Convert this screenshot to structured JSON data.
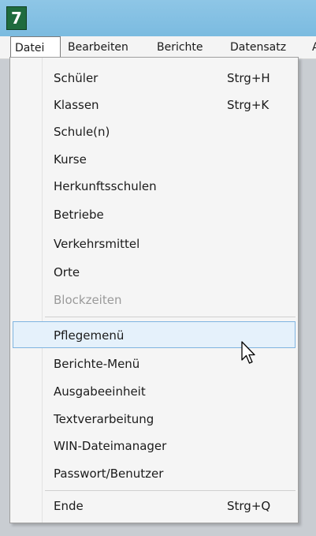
{
  "app": {
    "icon_glyph": "7",
    "icon_color": "#1f6b3e"
  },
  "menubar": {
    "items": [
      {
        "label": "Datei"
      },
      {
        "label": "Bearbeiten"
      },
      {
        "label": "Berichte"
      },
      {
        "label": "Datensatz"
      },
      {
        "label": "A"
      }
    ]
  },
  "menu": {
    "items": [
      {
        "label": "Schüler",
        "shortcut": "Strg+H"
      },
      {
        "label": "Klassen",
        "shortcut": "Strg+K"
      },
      {
        "label": "Schule(n)"
      },
      {
        "label": "Kurse"
      },
      {
        "label": "Herkunftsschulen"
      },
      {
        "label": "Betriebe"
      },
      {
        "label": "Verkehrsmittel"
      },
      {
        "label": "Orte"
      },
      {
        "label": "Blockzeiten",
        "disabled": true
      },
      {
        "label": "Pflegemenü",
        "highlighted": true
      },
      {
        "label": "Berichte-Menü"
      },
      {
        "label": "Ausgabeeinheit"
      },
      {
        "label": "Textverarbeitung"
      },
      {
        "label": "WIN-Dateimanager"
      },
      {
        "label": "Passwort/Benutzer"
      },
      {
        "label": "Ende",
        "shortcut": "Strg+Q"
      }
    ]
  },
  "colors": {
    "highlight_bg": "#e5f1fb",
    "highlight_border": "#7fb4e0",
    "disabled_text": "#9a9a9a"
  },
  "cursor": {
    "icon": "mouse-pointer-icon"
  }
}
